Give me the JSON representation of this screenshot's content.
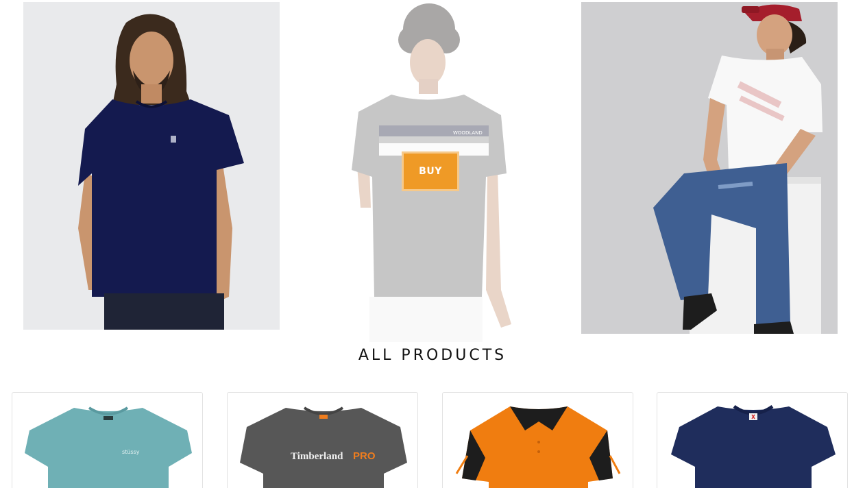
{
  "hero": {
    "items": [
      {
        "alt": "navy-tshirt-model"
      },
      {
        "alt": "grey-striped-tshirt-model",
        "buy_label": "BUY",
        "print": "WOODLAND"
      },
      {
        "alt": "white-tshirt-model-jeans"
      }
    ]
  },
  "section": {
    "title": "ALL PRODUCTS"
  },
  "products": [
    {
      "name": "teal-tshirt",
      "color": "#6fb0b5"
    },
    {
      "name": "grey-timberland-pro-tshirt",
      "color": "#5a5a5a",
      "logo_text": "Timberland",
      "logo_accent": "PRO"
    },
    {
      "name": "orange-black-polo",
      "color": "#f07d10"
    },
    {
      "name": "navy-tshirt",
      "color": "#1f2d5c"
    }
  ],
  "colors": {
    "accent": "#ef9a26",
    "text": "#111111",
    "card_border": "#e2e2e2"
  }
}
